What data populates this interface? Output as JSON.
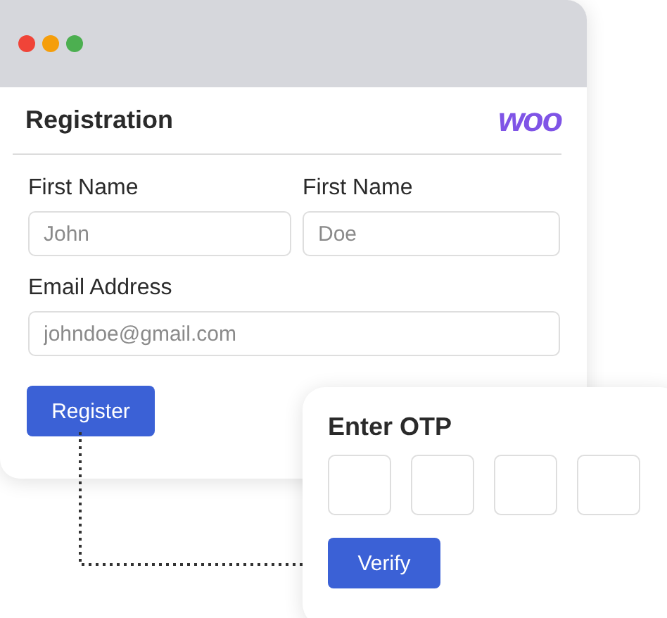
{
  "window": {
    "controls": [
      {
        "color": "#f04438"
      },
      {
        "color": "#f59e0b"
      },
      {
        "color": "#4caf50"
      }
    ]
  },
  "registration": {
    "title": "Registration",
    "logo": "woo",
    "field_rows": [
      [
        {
          "label": "First Name",
          "placeholder": "John"
        },
        {
          "label": "First Name",
          "placeholder": "Doe"
        }
      ],
      [
        {
          "label": "Email Address",
          "placeholder": "johndoe@gmail.com"
        }
      ]
    ],
    "button": "Register"
  },
  "otp": {
    "title": "Enter OTP",
    "button": "Verify"
  }
}
